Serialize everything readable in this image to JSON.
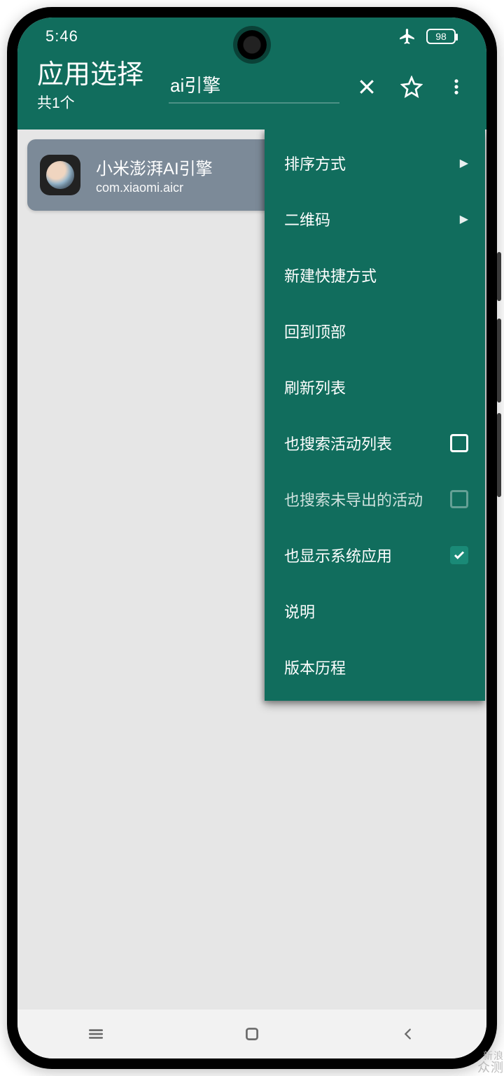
{
  "status": {
    "time": "5:46",
    "battery": "98"
  },
  "appbar": {
    "title": "应用选择",
    "subtitle": "共1个",
    "search_value": "ai引擎"
  },
  "list": {
    "items": [
      {
        "name": "小米澎湃AI引擎",
        "package": "com.xiaomi.aicr"
      }
    ]
  },
  "menu": {
    "sort": "排序方式",
    "qrcode": "二维码",
    "shortcut": "新建快捷方式",
    "to_top": "回到顶部",
    "refresh": "刷新列表",
    "search_activities": "也搜索活动列表",
    "search_unexported": "也搜索未导出的活动",
    "show_system": "也显示系统应用",
    "help": "说明",
    "changelog": "版本历程",
    "search_activities_checked": false,
    "search_unexported_checked": false,
    "show_system_checked": true
  },
  "watermark": {
    "line1": "新浪",
    "line2": "众测"
  }
}
